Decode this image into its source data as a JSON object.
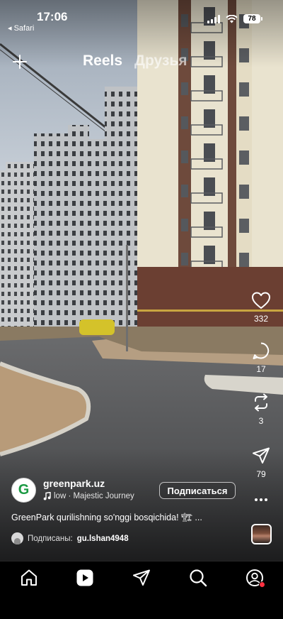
{
  "status_bar": {
    "time": "17:06",
    "back_app": "◂ Safari",
    "battery": "78"
  },
  "header": {
    "tabs": [
      {
        "label": "Reels",
        "active": true
      },
      {
        "label": "Друзья",
        "active": false
      }
    ]
  },
  "actions": {
    "likes": "332",
    "comments": "17",
    "reposts": "3",
    "shares": "79"
  },
  "post": {
    "avatar_letter": "G",
    "username": "greenpark.uz",
    "audio": "low · Majestic Journey",
    "subscribe_label": "Подписаться",
    "caption": "GreenPark qurilishning so'nggi bosqichida! 🏗 ...",
    "subscribers_label": "Подписаны:",
    "subscriber_user": "gu.lshan4948"
  },
  "icons": {
    "create": "plus-icon",
    "like": "heart-icon",
    "comment": "comment-bubble-icon",
    "repost": "repost-icon",
    "share": "paper-plane-icon",
    "more": "more-horizontal-icon",
    "music": "music-note-icon",
    "home": "home-icon",
    "reels": "reels-icon",
    "messages": "paper-plane-icon",
    "search": "search-icon",
    "profile": "profile-icon"
  },
  "colors": {
    "notification_dot": "#ff3040",
    "brand_green": "#1b9a43"
  }
}
